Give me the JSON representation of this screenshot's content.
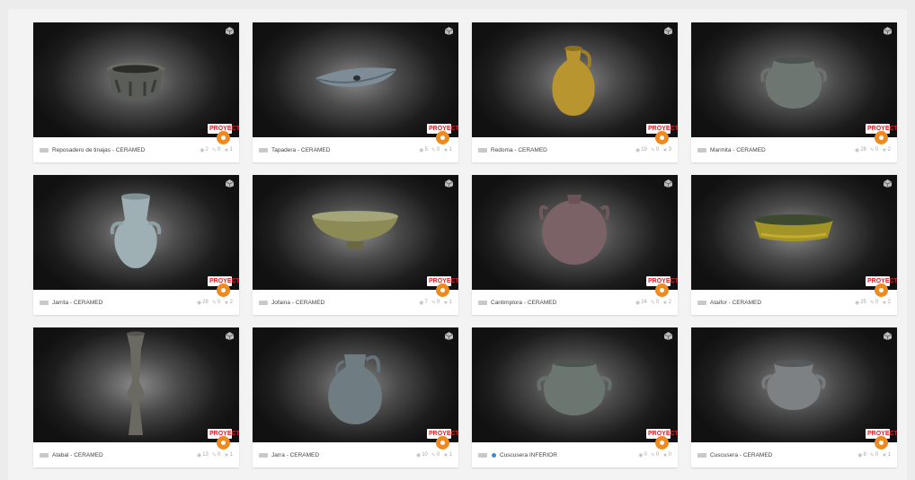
{
  "logo_text": "PROYECTA",
  "icons": {
    "three_d": "3d-cube-icon",
    "views": "eye-icon",
    "comments": "comment-icon",
    "likes": "star-icon",
    "badge": "staffpick-badge-icon"
  },
  "colors": {
    "badge_orange": "#f08a1c",
    "logo_red": "#d8232a",
    "collection_blue": "#3a8ed8"
  },
  "models": [
    {
      "title": "Reposadero de tinajas - CERAMED",
      "views": "2",
      "comments": "0",
      "likes": "1"
    },
    {
      "title": "Tapadera - CERAMED",
      "views": "5",
      "comments": "0",
      "likes": "1"
    },
    {
      "title": "Redoma - CERAMED",
      "views": "19",
      "comments": "0",
      "likes": "3"
    },
    {
      "title": "Marmita - CERAMED",
      "views": "28",
      "comments": "0",
      "likes": "2"
    },
    {
      "title": "Jarrita - CERAMED",
      "views": "28",
      "comments": "0",
      "likes": "2"
    },
    {
      "title": "Jofaina - CERAMED",
      "views": "7",
      "comments": "0",
      "likes": "1"
    },
    {
      "title": "Cantimplora - CERAMED",
      "views": "24",
      "comments": "0",
      "likes": "2"
    },
    {
      "title": "Ataifor - CERAMED",
      "views": "25",
      "comments": "0",
      "likes": "2"
    },
    {
      "title": "Atabal - CERAMED",
      "views": "13",
      "comments": "0",
      "likes": "1"
    },
    {
      "title": "Jarra - CERAMED",
      "views": "10",
      "comments": "0",
      "likes": "1"
    },
    {
      "title": "Cuscusera INFERIOR",
      "views": "0",
      "comments": "0",
      "likes": "0"
    },
    {
      "title": "Cuscusera - CERAMED",
      "views": "8",
      "comments": "0",
      "likes": "1"
    }
  ]
}
